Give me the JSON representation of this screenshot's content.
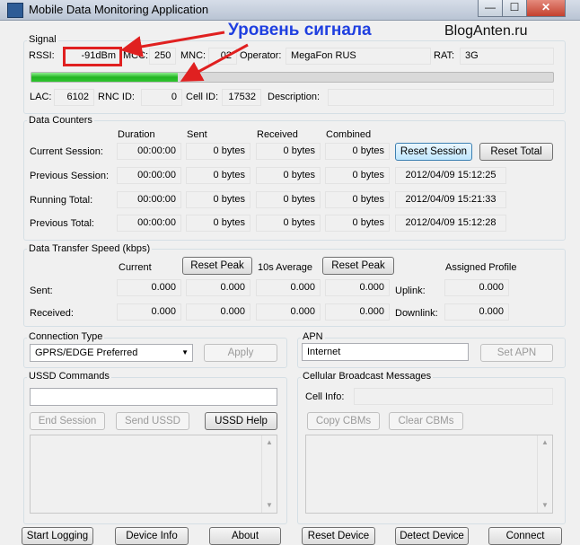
{
  "window": {
    "title": "Mobile Data Monitoring Application",
    "minimize": "—",
    "maximize": "☐",
    "close": "✕"
  },
  "annotation": {
    "callout": "Уровень сигнала",
    "watermark": "BlogAnten.ru"
  },
  "signal": {
    "group": "Signal",
    "rssi_label": "RSSI:",
    "rssi": "-91dBm",
    "mcc_label": "MCC:",
    "mcc": "250",
    "mnc_label": "MNC:",
    "mnc": "02",
    "operator_label": "Operator:",
    "operator": "MegaFon RUS",
    "rat_label": "RAT:",
    "rat": "3G",
    "level_fraction": 0.28,
    "lac_label": "LAC:",
    "lac": "6102",
    "rnc_label": "RNC ID:",
    "rnc": "0",
    "cell_label": "Cell ID:",
    "cell": "17532",
    "desc_label": "Description:",
    "desc": ""
  },
  "counters": {
    "group": "Data Counters",
    "headers": {
      "duration": "Duration",
      "sent": "Sent",
      "received": "Received",
      "combined": "Combined"
    },
    "rows": [
      {
        "label": "Current Session:",
        "duration": "00:00:00",
        "sent": "0 bytes",
        "received": "0 bytes",
        "combined": "0 bytes"
      },
      {
        "label": "Previous Session:",
        "duration": "00:00:00",
        "sent": "0 bytes",
        "received": "0 bytes",
        "combined": "0 bytes",
        "time": "2012/04/09 15:12:25"
      },
      {
        "label": "Running Total:",
        "duration": "00:00:00",
        "sent": "0 bytes",
        "received": "0 bytes",
        "combined": "0 bytes",
        "time": "2012/04/09 15:21:33"
      },
      {
        "label": "Previous Total:",
        "duration": "00:00:00",
        "sent": "0 bytes",
        "received": "0 bytes",
        "combined": "0 bytes",
        "time": "2012/04/09 15:12:28"
      }
    ],
    "reset_session": "Reset Session",
    "reset_total": "Reset Total"
  },
  "speed": {
    "group": "Data Transfer Speed (kbps)",
    "current": "Current",
    "reset_peak": "Reset Peak",
    "avg10": "10s Average",
    "assigned": "Assigned Profile",
    "sent_label": "Sent:",
    "received_label": "Received:",
    "uplink_label": "Uplink:",
    "downlink_label": "Downlink:",
    "sent": [
      "0.000",
      "0.000",
      "0.000",
      "0.000"
    ],
    "received": [
      "0.000",
      "0.000",
      "0.000",
      "0.000"
    ],
    "uplink": "0.000",
    "downlink": "0.000"
  },
  "connection": {
    "group": "Connection Type",
    "selected": "GPRS/EDGE Preferred",
    "apply": "Apply"
  },
  "apn": {
    "group": "APN",
    "value": "Internet",
    "set": "Set APN"
  },
  "ussd": {
    "group": "USSD Commands",
    "end": "End Session",
    "send": "Send USSD",
    "help": "USSD Help"
  },
  "cbm": {
    "group": "Cellular Broadcast Messages",
    "cell_info_label": "Cell Info:",
    "copy": "Copy CBMs",
    "clear": "Clear CBMs"
  },
  "bottom": {
    "start_logging": "Start Logging",
    "device_info": "Device Info",
    "about": "About",
    "reset_device": "Reset Device",
    "detect_device": "Detect Device",
    "connect": "Connect"
  },
  "colors": {
    "progress_green": "#2fc42f",
    "progress_track": "#d9d9d9",
    "callout_blue": "#1f3fe0",
    "highlight_red": "#e02020"
  }
}
